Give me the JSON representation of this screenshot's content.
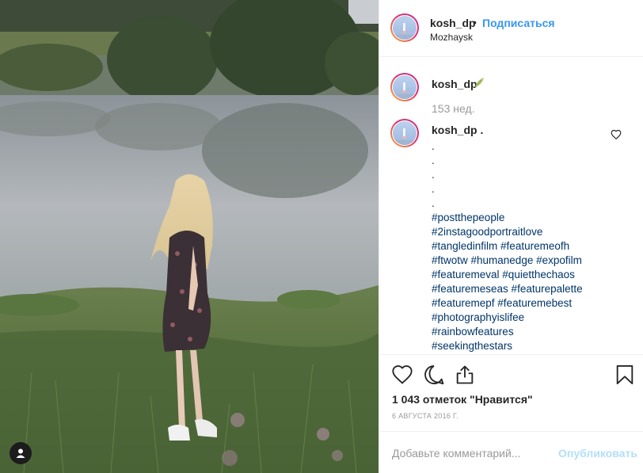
{
  "post": {
    "username": "kosh_dp",
    "follow_label": "Подписаться",
    "separator": "•",
    "location": "Mozhaysk"
  },
  "comments": [
    {
      "username": "kosh_dp",
      "badge_icon": "leaf-icon",
      "time_ago": "153 нед."
    },
    {
      "username": "kosh_dp .",
      "dots": [
        ".",
        ".",
        ".",
        ".",
        "."
      ],
      "hashtags": [
        "#postthepeople",
        "#2instagoodportraitlove",
        "#tangledinfilm #featuremeofh",
        "#ftwotw #humanedge #expofilm",
        "#featuremeval #quietthechaos",
        "#featuremeseas #featurepalette",
        "#featuremepf #featuremebest",
        "#photographyislifee",
        "#rainbowfeatures",
        "#seekingthestars"
      ]
    }
  ],
  "actions": {
    "icons": [
      "heart-icon",
      "comment-icon",
      "share-icon",
      "bookmark-icon"
    ],
    "likes_text": "1 043 отметок \"Нравится\"",
    "date": "6 АВГУСТА 2016 Г."
  },
  "comment_box": {
    "placeholder": "Добавьте комментарий...",
    "publish_label": "Опубликовать"
  },
  "colors": {
    "link_blue": "#3897f0",
    "hashtag": "#003569",
    "muted": "#999999",
    "publish_disabled": "#b2dffc"
  }
}
